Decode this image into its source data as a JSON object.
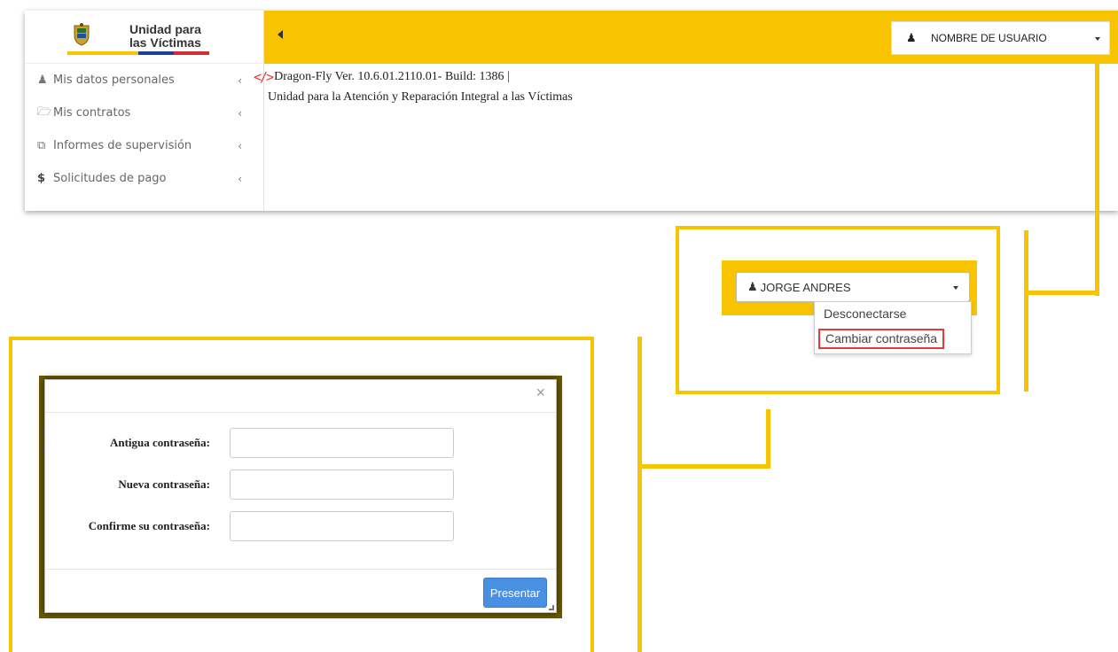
{
  "brand": {
    "line1": "Unidad para",
    "line2": "las Víctimas"
  },
  "colors": {
    "accent": "#f8c300",
    "highlight": "#e53935",
    "primary_button": "#4a90e2"
  },
  "sidebar": {
    "items": [
      {
        "icon": "user-icon",
        "label": "Mis datos personales"
      },
      {
        "icon": "folder-icon",
        "label": "Mis contratos"
      },
      {
        "icon": "copy-icon",
        "label": "Informes de supervisión"
      },
      {
        "icon": "dollar-icon",
        "label": "Solicitudes de pago"
      }
    ]
  },
  "header": {
    "user_label": "NOMBRE DE USUARIO"
  },
  "content": {
    "version": "Dragon-Fly Ver. 10.6.01.2110.01- Build: 1386  |",
    "org": "Unidad para la Atención y Reparación Integral a las Víctimas"
  },
  "dropdown": {
    "user": "JORGE ANDRES",
    "options": [
      "Desconectarse",
      "Cambiar contraseña"
    ]
  },
  "modal": {
    "close": "×",
    "fields": [
      {
        "label": "Antigua contraseña:"
      },
      {
        "label": "Nueva contraseña:"
      },
      {
        "label": "Confirme su contraseña:"
      }
    ],
    "submit": "Presentar"
  }
}
